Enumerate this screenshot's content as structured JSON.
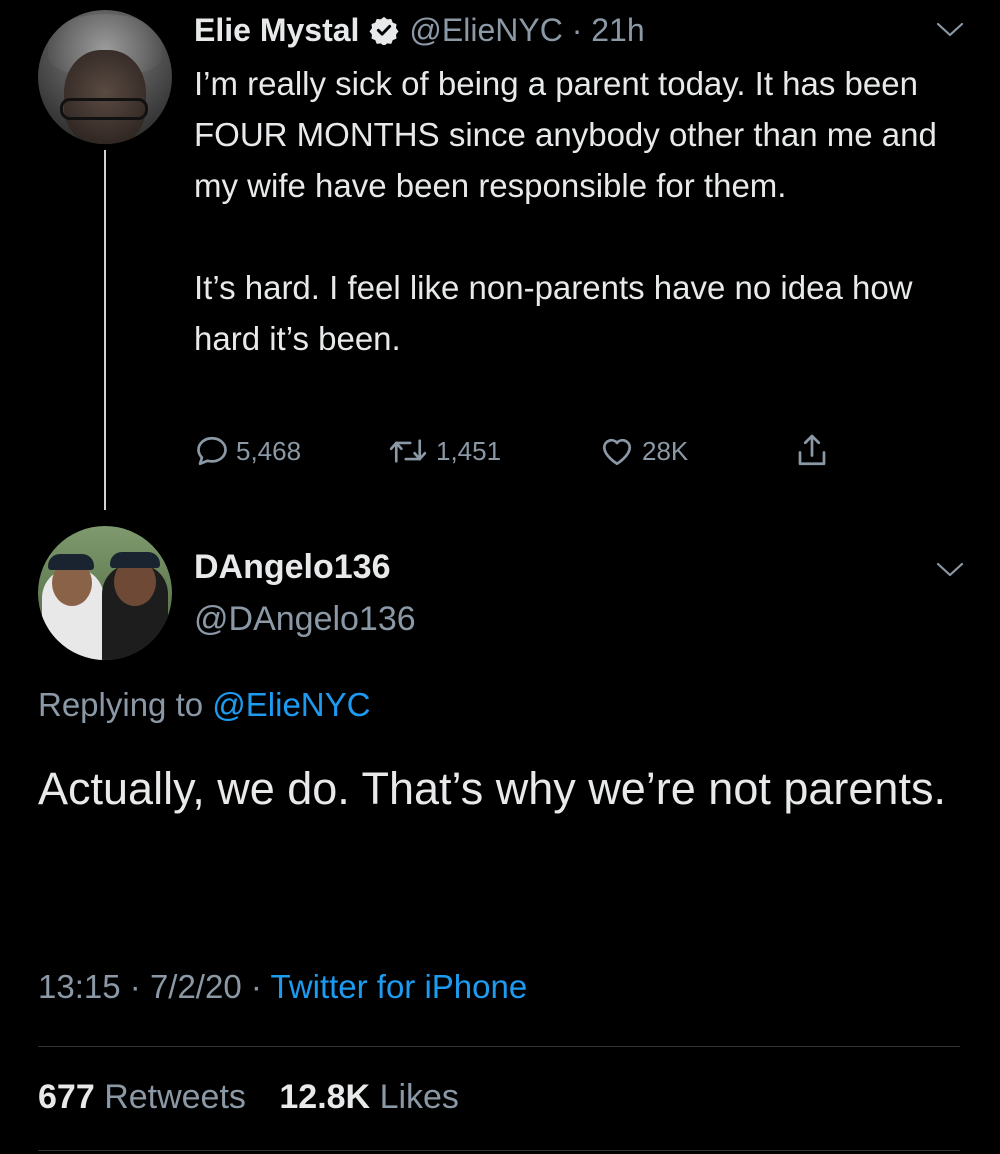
{
  "tweet": {
    "author_name": "Elie Mystal",
    "handle": "@ElieNYC",
    "separator": "·",
    "time": "21h",
    "text_paragraphs": [
      "I’m really sick of being a parent today. It has been FOUR MONTHS since anybody other than me and my wife have been responsible for them.",
      "It’s hard. I feel like non-parents have no idea how hard it’s been."
    ],
    "actions": {
      "replies": "5,468",
      "retweets": "1,451",
      "likes": "28K"
    }
  },
  "reply": {
    "author_name": "DAngelo136",
    "handle": "@DAngelo136",
    "replying_to_prefix": "Replying to",
    "replying_to_handle": "@ElieNYC",
    "text": "Actually, we do. That’s why we’re not parents.",
    "time": "13:15",
    "date": "7/2/20",
    "separator": "·",
    "source": "Twitter for iPhone",
    "stats": {
      "retweets_count": "677",
      "retweets_label": "Retweets",
      "likes_count": "12.8K",
      "likes_label": "Likes"
    }
  },
  "colors": {
    "background": "#000000",
    "text_primary": "#e7e9ea",
    "text_secondary": "#8b98a5",
    "link_blue": "#1d9bf0"
  },
  "icons": [
    "verified-badge-icon",
    "chevron-down-icon",
    "reply-icon",
    "retweet-icon",
    "like-icon",
    "share-icon"
  ]
}
